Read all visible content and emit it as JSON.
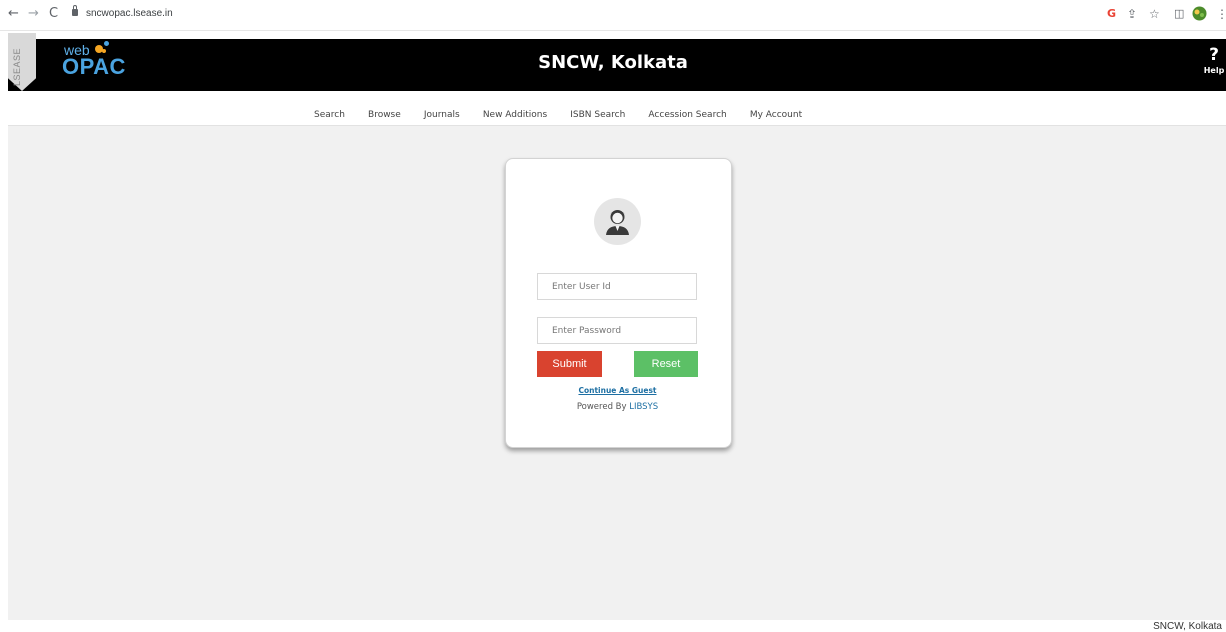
{
  "browser": {
    "url": "sncwopac.lsease.in",
    "back_glyph": "←",
    "forward_glyph": "→",
    "reload_glyph": "C",
    "ext_icons": [
      "google-icon",
      "share-icon",
      "star-icon",
      "sidepanel-icon",
      "profile-icon",
      "more-icon"
    ]
  },
  "header": {
    "side_tab": "LSEASE",
    "logo_web": "web",
    "logo_opac": "OPAC",
    "title": "SNCW, Kolkata",
    "help_symbol": "?",
    "help_label": "Help"
  },
  "menu": {
    "items": [
      "Search",
      "Browse",
      "Journals",
      "New Additions",
      "ISBN Search",
      "Accession Search",
      "My Account"
    ]
  },
  "login": {
    "user_placeholder": "Enter User Id",
    "password_placeholder": "Enter Password",
    "submit_label": "Submit",
    "reset_label": "Reset",
    "guest_link": "Continue As Guest",
    "powered_prefix": "Powered By",
    "powered_brand": "LIBSYS"
  },
  "footer": {
    "text": "SNCW, Kolkata"
  },
  "colors": {
    "header_bg": "#000000",
    "page_bg": "#f1f1f1",
    "submit": "#d9432f",
    "reset": "#5cc066",
    "link": "#1d6fa3",
    "logo": "#4aa3e0"
  }
}
